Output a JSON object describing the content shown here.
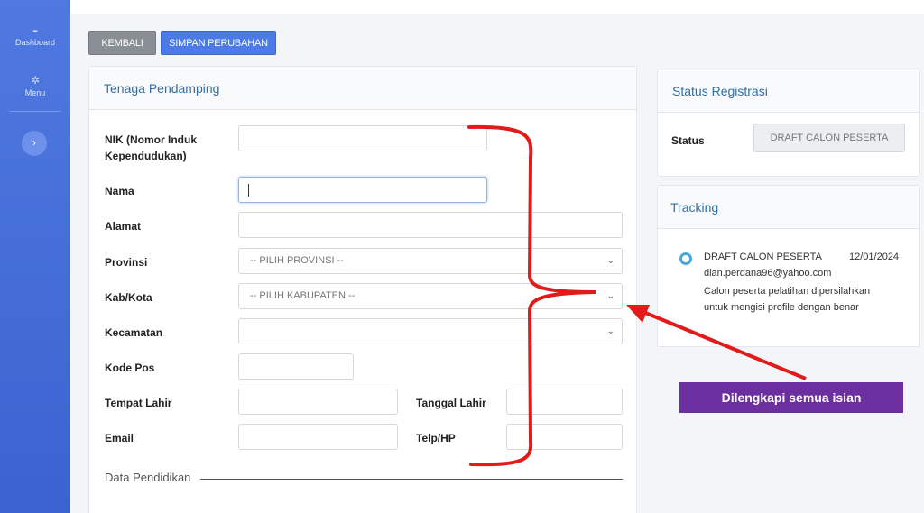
{
  "sidebar": {
    "items": [
      {
        "label": "Dashboard",
        "icon": "dashboard-icon"
      },
      {
        "label": "Menu",
        "icon": "gear-icon"
      }
    ],
    "toggle_icon": "›"
  },
  "toolbar": {
    "back_label": "KEMBALI",
    "save_label": "SIMPAN PERUBAHAN"
  },
  "form": {
    "title": "Tenaga Pendamping",
    "fields": {
      "nik_label": "NIK (Nomor Induk Kependudukan)",
      "nama_label": "Nama",
      "alamat_label": "Alamat",
      "provinsi_label": "Provinsi",
      "provinsi_value": "-- PILIH PROVINSI --",
      "kabkota_label": "Kab/Kota",
      "kabkota_value": "-- PILIH KABUPATEN --",
      "kecamatan_label": "Kecamatan",
      "kodepos_label": "Kode Pos",
      "tempat_lahir_label": "Tempat Lahir",
      "tanggal_lahir_label": "Tanggal Lahir",
      "email_label": "Email",
      "telp_label": "Telp/HP"
    },
    "section_pendidikan": "Data Pendidikan"
  },
  "status": {
    "title": "Status Registrasi",
    "label": "Status",
    "value": "DRAFT CALON PESERTA"
  },
  "tracking": {
    "title": "Tracking",
    "entry": {
      "status": "DRAFT CALON PESERTA",
      "date": "12/01/2024",
      "email": "dian.perdana96@yahoo.com",
      "message_line1": "Calon peserta pelatihan dipersilahkan",
      "message_line2": "untuk mengisi profile dengan benar"
    }
  },
  "annotation": {
    "text": "Dilengkapi semua isian",
    "bracket_color": "#e11a1a",
    "box_color": "#6b2fa0"
  },
  "colors": {
    "sidebar": "#4f79e0",
    "primary_button": "#4c7ae6",
    "secondary_button": "#8a8e95",
    "link_title": "#2f6fa8"
  }
}
